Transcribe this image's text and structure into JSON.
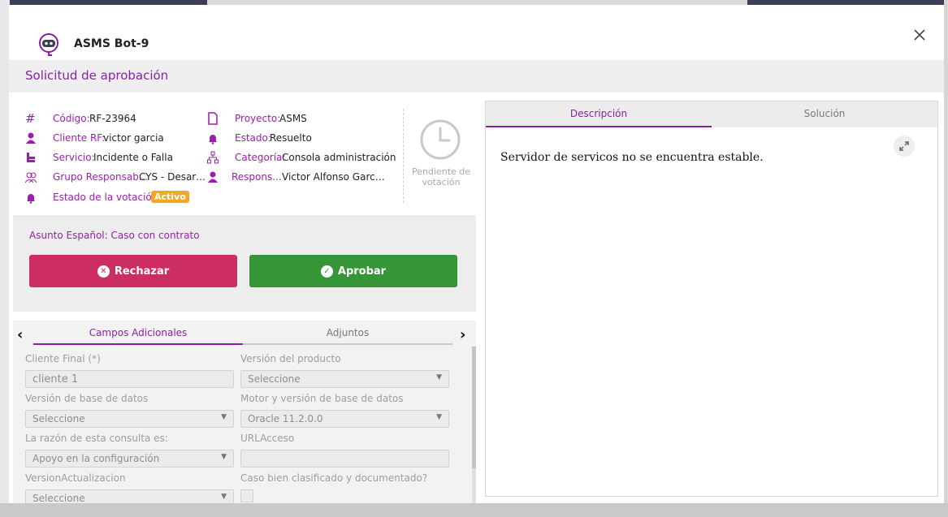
{
  "header": {
    "bot_name": "ASMS Bot-9"
  },
  "subheader": {
    "title": "Solicitud de aprobación"
  },
  "details": {
    "codigo": {
      "label": "Código:",
      "value": "RF-23964"
    },
    "cliente": {
      "label": "Cliente RF:",
      "value": "victor garcia"
    },
    "servicio": {
      "label": "Servicio:",
      "value": "Incidente o Falla"
    },
    "grupo": {
      "label": "Grupo Responsab...",
      "value": "CYS - Desarro..."
    },
    "votacion": {
      "label": "Estado de la votación:",
      "value": "Activo"
    },
    "proyecto": {
      "label": "Proyecto:",
      "value": "ASMS"
    },
    "estado": {
      "label": "Estado:",
      "value": "Resuelto"
    },
    "categoria": {
      "label": "Categoría:",
      "value": "Consola administración"
    },
    "responsable": {
      "label": "Respons...",
      "value": "Victor Alfonso Garcia ..."
    }
  },
  "pending": {
    "line1": "Pendiente de",
    "line2": "votación"
  },
  "subject": {
    "label": "Asunto Español:",
    "value": "Caso con contrato"
  },
  "actions": {
    "reject": "Rechazar",
    "approve": "Aprobar"
  },
  "lower_tabs": {
    "active": "Campos Adicionales",
    "inactive": "Adjuntos"
  },
  "form": {
    "cliente_final": {
      "label": "Cliente Final (*)",
      "value": "cliente 1"
    },
    "version_producto": {
      "label": "Versión del producto",
      "value": "Seleccione"
    },
    "version_bd": {
      "label": "Versión de base de datos",
      "value": "Seleccione"
    },
    "motor_bd": {
      "label": "Motor y versión de base de datos",
      "value": "Oracle 11.2.0.0"
    },
    "razon": {
      "label": "La razón de esta consulta es:",
      "value": "Apoyo en la configuración"
    },
    "url": {
      "label": "URLAcceso",
      "value": ""
    },
    "version_act": {
      "label": "VersionActualizacion",
      "value": "Seleccione"
    },
    "caso_clasificado": {
      "label": "Caso bien clasificado y documentado?"
    }
  },
  "right_tabs": {
    "active": "Descripción",
    "inactive": "Solución"
  },
  "description": "Servidor de servicos no se encuentra estable.",
  "colors": {
    "accent": "#8a1fa5",
    "reject": "#cc2e62",
    "approve": "#359637",
    "badge": "#f5a623"
  }
}
